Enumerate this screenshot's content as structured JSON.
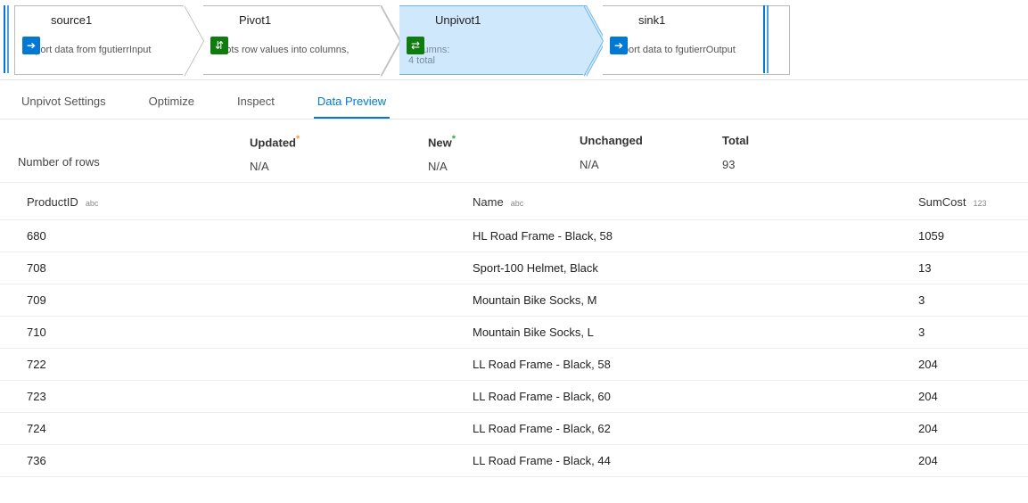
{
  "flow": {
    "nodes": [
      {
        "id": "source",
        "title": "source1",
        "desc": "Import data from fgutierrInput",
        "icon": "source-icon"
      },
      {
        "id": "pivot",
        "title": "Pivot1",
        "desc": "Pivots row values into columns, groups columns and",
        "icon": "pivot-icon"
      },
      {
        "id": "unpivot",
        "title": "Unpivot1",
        "desc": "Columns:",
        "desc2": "4 total",
        "icon": "unpivot-icon"
      },
      {
        "id": "sink",
        "title": "sink1",
        "desc": "Export data to fgutierrOutput",
        "icon": "sink-icon"
      }
    ]
  },
  "tabs": {
    "items": [
      "Unpivot Settings",
      "Optimize",
      "Inspect",
      "Data Preview"
    ],
    "selected": 3
  },
  "stats": {
    "row_label": "Number of rows",
    "columns": [
      {
        "header": "Updated",
        "marker": "ast-y",
        "value": "N/A"
      },
      {
        "header": "New",
        "marker": "ast-g",
        "value": "N/A"
      },
      {
        "header": "Unchanged",
        "marker": "",
        "value": "N/A"
      },
      {
        "header": "Total",
        "marker": "",
        "value": "93"
      }
    ]
  },
  "grid": {
    "columns": [
      {
        "name": "ProductID",
        "type": "abc"
      },
      {
        "name": "Name",
        "type": "abc"
      },
      {
        "name": "SumCost",
        "type": "123"
      }
    ],
    "rows": [
      {
        "ProductID": "680",
        "Name": "HL Road Frame - Black, 58",
        "SumCost": "1059"
      },
      {
        "ProductID": "708",
        "Name": "Sport-100 Helmet, Black",
        "SumCost": "13"
      },
      {
        "ProductID": "709",
        "Name": "Mountain Bike Socks, M",
        "SumCost": "3"
      },
      {
        "ProductID": "710",
        "Name": "Mountain Bike Socks, L",
        "SumCost": "3"
      },
      {
        "ProductID": "722",
        "Name": "LL Road Frame - Black, 58",
        "SumCost": "204"
      },
      {
        "ProductID": "723",
        "Name": "LL Road Frame - Black, 60",
        "SumCost": "204"
      },
      {
        "ProductID": "724",
        "Name": "LL Road Frame - Black, 62",
        "SumCost": "204"
      },
      {
        "ProductID": "736",
        "Name": "LL Road Frame - Black, 44",
        "SumCost": "204"
      }
    ]
  }
}
